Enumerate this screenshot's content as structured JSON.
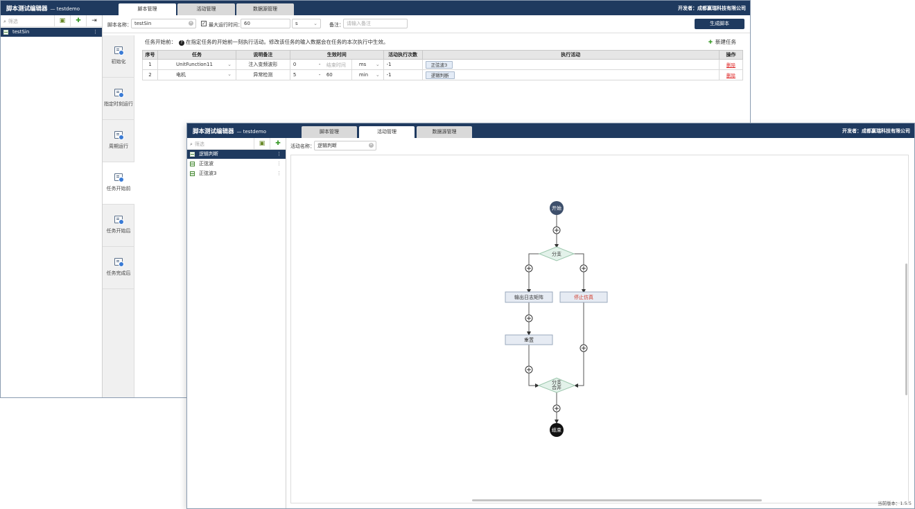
{
  "app": {
    "title": "脚本测试编辑器",
    "project": "— testdemo",
    "developer": "开发者：成都赢瑞科技有限公司",
    "version": "当前版本：1.5.5"
  },
  "tabs": [
    "脚本管理",
    "活动管理",
    "数据源管理"
  ],
  "window1": {
    "active_tab": "脚本管理",
    "filter_placeholder": "筛选",
    "tree": [
      {
        "label": "testSin",
        "selected": true
      }
    ],
    "toolbar": {
      "script_name_label": "脚本名称：",
      "script_name_value": "testSin",
      "max_runtime_checked": true,
      "max_runtime_label": "最大运行时间：",
      "max_runtime_value": "60",
      "max_runtime_unit": "s",
      "remark_label": "备注：",
      "remark_placeholder": "请输入备注",
      "generate_button": "生成脚本"
    },
    "left_tabs": [
      {
        "label": "初始化",
        "active": false
      },
      {
        "label": "指定时刻运行",
        "active": false
      },
      {
        "label": "周期运行",
        "active": false
      },
      {
        "label": "任务开始前",
        "active": true
      },
      {
        "label": "任务开始后",
        "active": false
      },
      {
        "label": "任务完成后",
        "active": false
      }
    ],
    "description": {
      "prefix": "任务开始前：",
      "text": "在指定任务的开始前一刻执行活动。修改该任务的输入数据会在任务的本次执行中生效。"
    },
    "new_task_label": "新建任务",
    "table": {
      "headers": [
        "序号",
        "任务",
        "说明备注",
        "生效时间",
        "活动执行次数",
        "执行活动",
        "操作"
      ],
      "rows": [
        {
          "index": "1",
          "task": "UnitFunction11",
          "remark": "注入变频波形",
          "time_start": "0",
          "time_sep": "-",
          "time_end": "结束时间",
          "time_unit": "ms",
          "count": "-1",
          "activity": "正弦波3",
          "op": "删除"
        },
        {
          "index": "2",
          "task": "电机",
          "remark": "异常检测",
          "time_start": "5",
          "time_sep": "-",
          "time_end": "60",
          "time_unit": "min",
          "count": "-1",
          "activity": "逻辑判断",
          "op": "删除"
        }
      ]
    }
  },
  "window2": {
    "active_tab": "活动管理",
    "filter_placeholder": "筛选",
    "tree": [
      {
        "label": "逻辑判断",
        "selected": true
      },
      {
        "label": "正弦波",
        "selected": false
      },
      {
        "label": "正弦波3",
        "selected": false
      }
    ],
    "activity_name_label": "活动名称：",
    "activity_name_value": "逻辑判断",
    "flow": {
      "start": "开始",
      "branch": "分支",
      "left_action_1": "输出日志矩阵",
      "left_action_2": "重置",
      "right_action": "停止仿真",
      "merge_line1": "分支",
      "merge_line2": "合并",
      "end": "结束",
      "colors": {
        "node_dark": "#3d4f6b",
        "end": "#111111",
        "diamond_fill": "#e3f2ea",
        "box_fill": "#e6ebf3",
        "stop_text": "#d23a2a"
      }
    }
  }
}
